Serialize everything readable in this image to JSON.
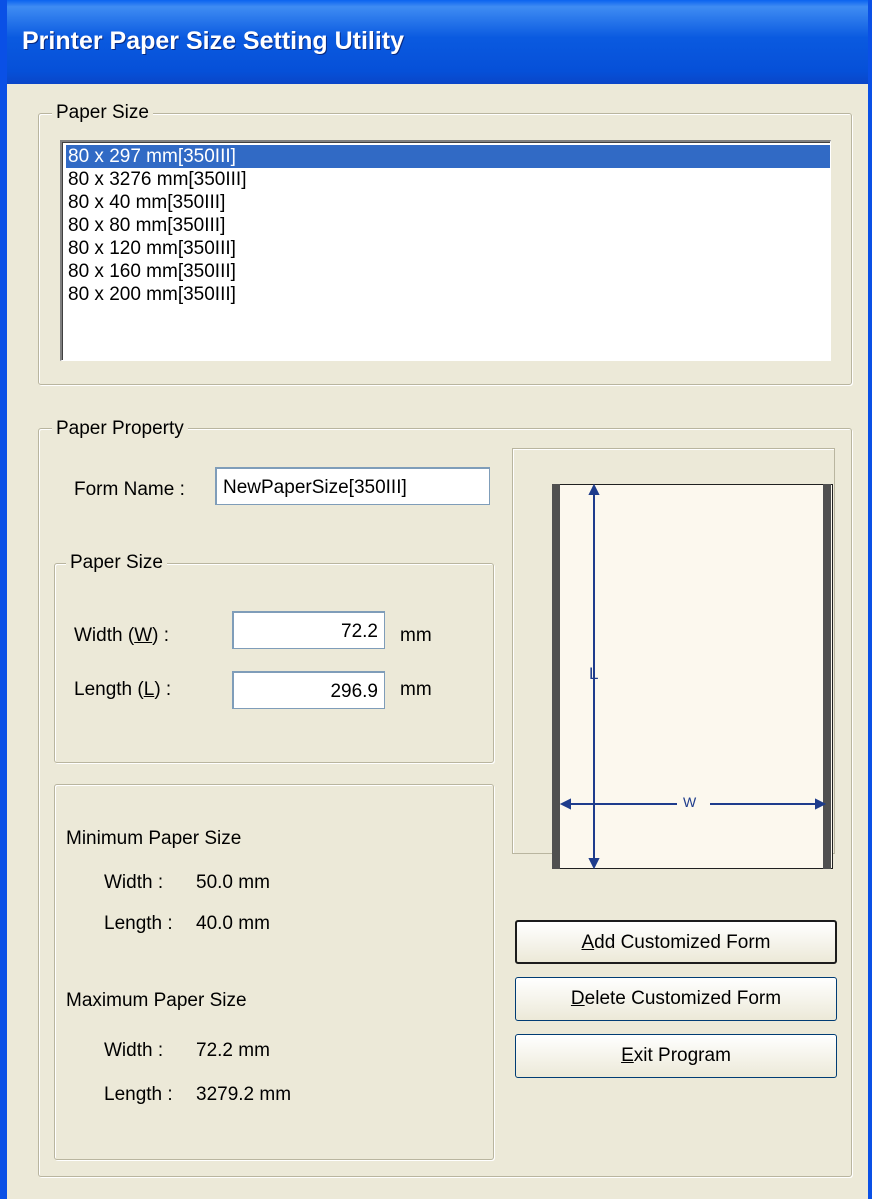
{
  "window": {
    "title": "Printer Paper Size Setting Utility"
  },
  "paper_size_group": {
    "legend": "Paper Size",
    "items": [
      "80 x 297 mm[350III]",
      "80 x 3276 mm[350III]",
      "80 x 40 mm[350III]",
      "80 x 80 mm[350III]",
      "80 x 120 mm[350III]",
      "80 x 160 mm[350III]",
      "80 x 200 mm[350III]"
    ],
    "selected_index": 0
  },
  "paper_property": {
    "legend": "Paper Property",
    "form_name_label": "Form Name :",
    "form_name_value": "NewPaperSize[350III]",
    "size_group": {
      "legend": "Paper Size",
      "width_label_pre": "Width (",
      "width_label_key": "W",
      "width_label_post": ") :",
      "width_value": "72.2",
      "width_unit": "mm",
      "length_label_pre": "Length (",
      "length_label_key": "L",
      "length_label_post": ") :",
      "length_value": "296.9",
      "length_unit": "mm"
    },
    "limits": {
      "min_title": "Minimum Paper Size",
      "min_width_label": "Width  :",
      "min_width_value": "50.0 mm",
      "min_length_label": "Length :",
      "min_length_value": "40.0 mm",
      "max_title": "Maximum Paper Size",
      "max_width_label": "Width  :",
      "max_width_value": "72.2 mm",
      "max_length_label": "Length :",
      "max_length_value": "3279.2 mm"
    },
    "preview": {
      "length_marker": "L",
      "width_marker": "W"
    }
  },
  "buttons": {
    "add_key": "A",
    "add_rest": "dd Customized Form",
    "delete_key": "D",
    "delete_rest": "elete Customized Form",
    "exit_key": "E",
    "exit_rest": "xit Program"
  },
  "colors": {
    "title_bar": "#0a5ae0",
    "selection": "#316ac5",
    "dimension_lines": "#1e3c8c",
    "paper": "#fcf8ee"
  }
}
